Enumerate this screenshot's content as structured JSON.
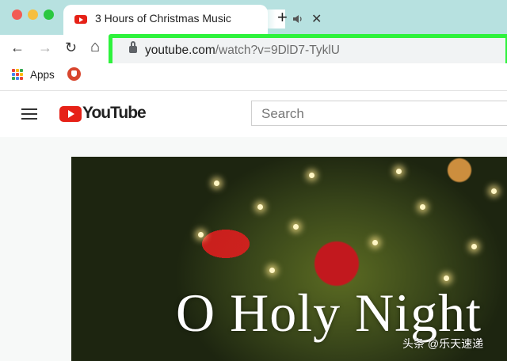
{
  "browser": {
    "tab": {
      "title": "3 Hours of Christmas Music",
      "favicon": "youtube-favicon-icon",
      "audio_icon": "speaker-icon",
      "close_glyph": "✕"
    },
    "new_tab_glyph": "+",
    "nav": {
      "back": "←",
      "forward": "→",
      "reload": "↻",
      "home": "⌂"
    },
    "address_bar": {
      "domain": "youtube.com",
      "path": "/watch?v=9DlD7-TyklU",
      "highlight_color": "#2ef23c"
    },
    "bookmarks": [
      {
        "label": "Apps",
        "icon": "apps-grid-icon"
      },
      {
        "label": "",
        "icon": "bookmark-favicon-icon"
      }
    ]
  },
  "youtube": {
    "logo_text": "YouTube",
    "search_placeholder": "Search"
  },
  "video": {
    "caption": "O Holy Night"
  },
  "watermark": "头条 @乐天速递",
  "colors": {
    "tabstrip": "#b7e1e0",
    "youtube_red": "#e62117",
    "traffic_red": "#f25c54",
    "traffic_yellow": "#f6bf3e",
    "traffic_green": "#2bc840"
  }
}
